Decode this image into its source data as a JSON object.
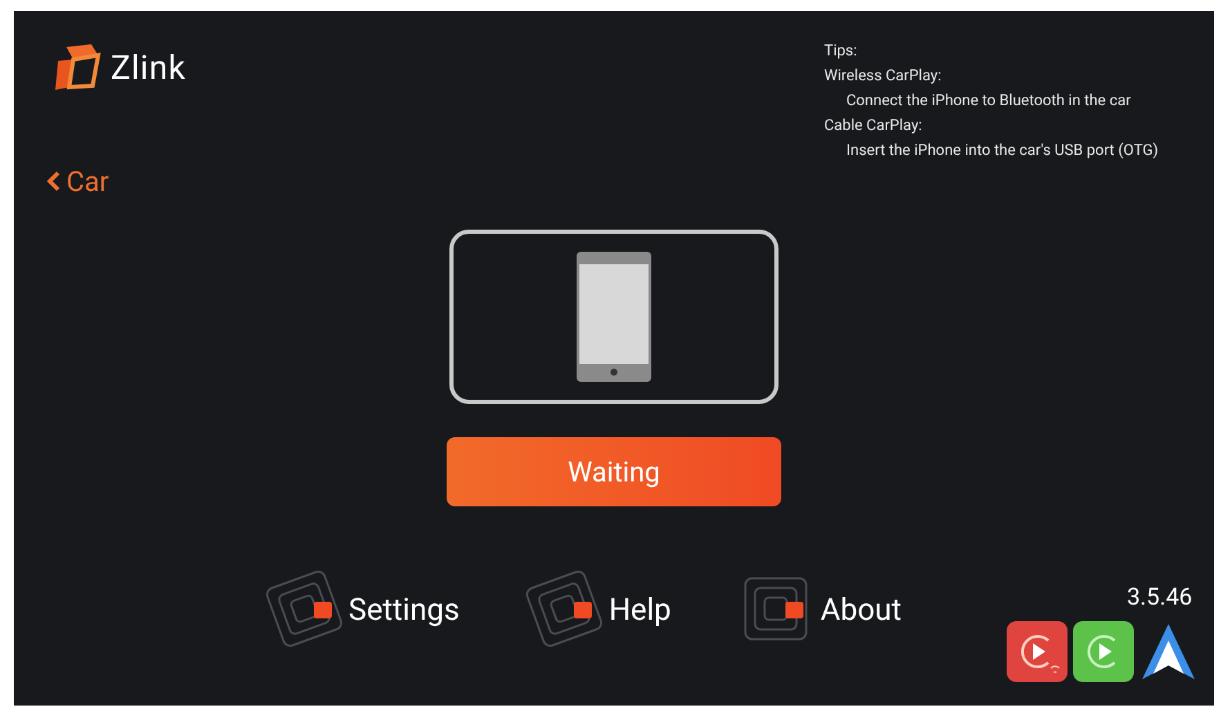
{
  "logo": {
    "text": "Zlink"
  },
  "back": {
    "label": "Car"
  },
  "tips": [
    {
      "kind": "heading",
      "text": "Tips:"
    },
    {
      "kind": "heading",
      "text": "Wireless CarPlay:"
    },
    {
      "kind": "detail",
      "text": "Connect the iPhone to Bluetooth in the car"
    },
    {
      "kind": "heading",
      "text": "Cable CarPlay:"
    },
    {
      "kind": "detail",
      "text": "Insert the iPhone into the car's USB port (OTG)"
    }
  ],
  "status_button": {
    "label": "Waiting"
  },
  "menu": [
    {
      "label": "Settings",
      "kind": "tilted"
    },
    {
      "label": "Help",
      "kind": "tilted"
    },
    {
      "label": "About",
      "kind": "straight"
    }
  ],
  "version": "3.5.46"
}
